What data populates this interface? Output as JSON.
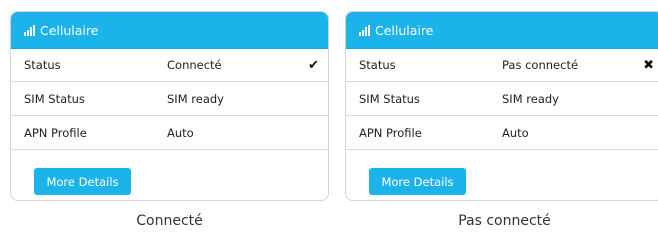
{
  "panels": [
    {
      "header": {
        "title": "Cellulaire",
        "icon": "signal-bars-icon"
      },
      "rows": [
        {
          "label": "Status",
          "value": "Connecté",
          "icon": "checkmark-icon",
          "glyph": "✔"
        },
        {
          "label": "SIM Status",
          "value": "SIM ready"
        },
        {
          "label": "APN Profile",
          "value": "Auto"
        }
      ],
      "button": "More Details",
      "caption": "Connecté"
    },
    {
      "header": {
        "title": "Cellulaire",
        "icon": "signal-bars-icon"
      },
      "rows": [
        {
          "label": "Status",
          "value": "Pas connecté",
          "icon": "cross-icon",
          "glyph": "✖"
        },
        {
          "label": "SIM Status",
          "value": "SIM ready"
        },
        {
          "label": "APN Profile",
          "value": "Auto"
        }
      ],
      "button": "More Details",
      "caption": "Pas connecté"
    }
  ],
  "colors": {
    "accent": "#1bb3ea",
    "border": "#d4d4d4",
    "text": "#222222"
  }
}
